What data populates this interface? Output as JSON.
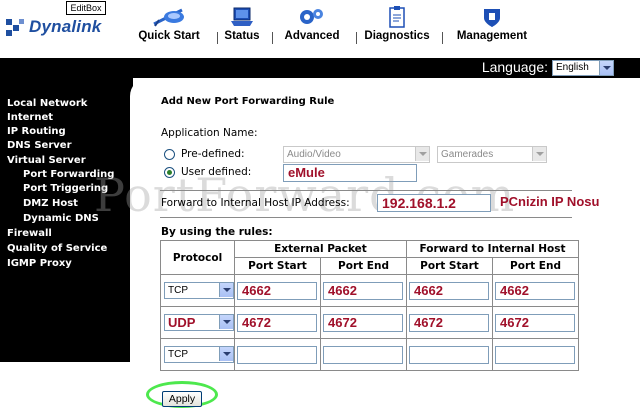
{
  "header": {
    "editbox_label": "EditBox",
    "logo_text": "Dynalink",
    "nav": [
      {
        "label": "Quick Start",
        "icon": "wizard-icon"
      },
      {
        "label": "Status",
        "icon": "laptop-icon"
      },
      {
        "label": "Advanced",
        "icon": "gears-icon"
      },
      {
        "label": "Diagnostics",
        "icon": "clipboard-icon"
      },
      {
        "label": "Management",
        "icon": "shield-icon"
      }
    ]
  },
  "language": {
    "label": "Language:",
    "value": "English"
  },
  "sidebar": {
    "items": [
      {
        "label": "Local Network",
        "indent": 0
      },
      {
        "label": "Internet",
        "indent": 0
      },
      {
        "label": "IP Routing",
        "indent": 0
      },
      {
        "label": "DNS Server",
        "indent": 0
      },
      {
        "label": "Virtual Server",
        "indent": 0
      },
      {
        "label": "Port Forwarding",
        "indent": 1
      },
      {
        "label": "Port Triggering",
        "indent": 1
      },
      {
        "label": "DMZ Host",
        "indent": 1
      },
      {
        "label": "Dynamic DNS",
        "indent": 1
      },
      {
        "label": "Firewall",
        "indent": 0
      },
      {
        "label": "Quality of Service",
        "indent": 0
      },
      {
        "label": "IGMP Proxy",
        "indent": 0
      }
    ]
  },
  "form": {
    "title": "Add New Port Forwarding Rule",
    "app_name_label": "Application Name:",
    "predefined_label": "Pre-defined:",
    "predefined_category": "Audio/Video",
    "predefined_app": "Gamerades",
    "user_defined_label": "User defined:",
    "user_defined_value": "eMule",
    "forward_ip_label": "Forward to Internal Host IP Address:",
    "forward_ip_value": "192.168.1.2",
    "ip_annotation": "PCnizin IP Nosu",
    "rules_label": "By using the rules:"
  },
  "table": {
    "protocol_header": "Protocol",
    "external_header": "External Packet",
    "internal_header": "Forward to Internal Host",
    "port_start_header": "Port Start",
    "port_end_header": "Port End",
    "rows": [
      {
        "protocol": "TCP",
        "ext_start": "4662",
        "ext_end": "4662",
        "int_start": "4662",
        "int_end": "4662"
      },
      {
        "protocol": "UDP",
        "ext_start": "4672",
        "ext_end": "4672",
        "int_start": "4672",
        "int_end": "4672"
      },
      {
        "protocol": "TCP",
        "ext_start": "",
        "ext_end": "",
        "int_start": "",
        "int_end": ""
      }
    ],
    "udp_annotation": "UDP"
  },
  "apply_label": "Apply",
  "watermark": "PortForward.com",
  "colors": {
    "accent_nav": "#1f4fa0",
    "annotation": "#a0102a",
    "highlight_ring": "#4de84d"
  }
}
